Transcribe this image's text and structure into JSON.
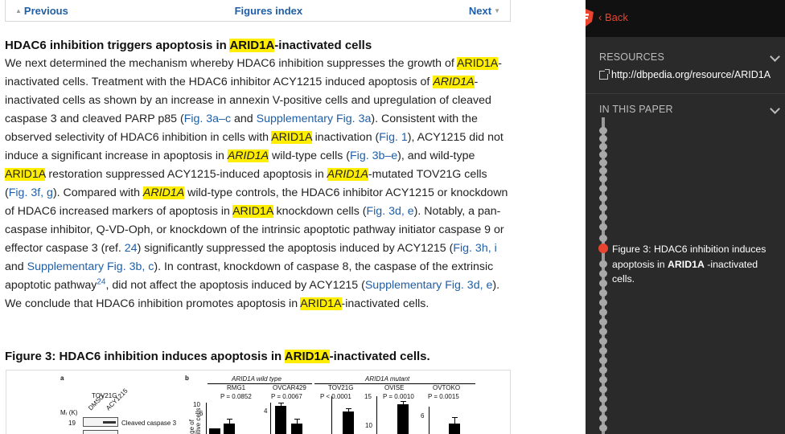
{
  "nav": {
    "previous": "Previous",
    "index": "Figures index",
    "next": "Next"
  },
  "article": {
    "section_heading_pre": "HDAC6 inhibition triggers apoptosis in ",
    "section_heading_gene": "ARID1A",
    "section_heading_post": "-inactivated cells",
    "figure_heading_pre": "Figure 3: HDAC6 inhibition induces apoptosis in ",
    "figure_heading_gene": "ARID1A",
    "figure_heading_post": "-inactivated cells."
  },
  "paragraph": {
    "s01": "We next determined the mechanism whereby HDAC6 inhibition suppresses the growth of ",
    "g01": "ARID1A",
    "s02": "-inactivated cells. Treatment with the HDAC6 inhibitor ACY1215 induced apoptosis of ",
    "g02": "ARID1A",
    "s03": "-inactivated cells as shown by an increase in annexin V-positive cells and upregulation of cleaved caspase 3 and cleaved PARP p85 (",
    "l01": "Fig. 3a–c",
    "s04": " and ",
    "l02": "Supplementary Fig. 3a",
    "s05": "). Consistent with the observed selectivity of HDAC6 inhibition in cells with ",
    "g03": "ARID1A",
    "s06": " inactivation (",
    "l03": "Fig. 1",
    "s07": "), ACY1215 did not induce a significant increase in apoptosis in ",
    "g04": "ARID1A",
    "s08": " wild-type cells (",
    "l04": "Fig. 3b–e",
    "s09": "), and wild-type ",
    "g05": "ARID1A",
    "s10": " restoration suppressed ACY1215-induced apoptosis in ",
    "g06": "ARID1A",
    "s11": "-mutated TOV21G cells (",
    "l05": "Fig. 3f, g",
    "s12": "). Compared with ",
    "g07": "ARID1A",
    "s13": " wild-type controls, the HDAC6 inhibitor ACY1215 or knockdown of HDAC6 increased markers of apoptosis in ",
    "g08": "ARID1A",
    "s14": " knockdown cells (",
    "l06": "Fig. 3d, e",
    "s15": "). Notably, a pan-caspase inhibitor, Q-VD-Oph, or knockdown of the intrinsic apoptotic pathway initiator caspase 9 or effector caspase 3 (ref. ",
    "l07": "24",
    "s16": ") significantly suppressed the apoptosis induced by ACY1215 (",
    "l08": "Fig. 3h, i",
    "s17": " and ",
    "l09": "Supplementary Fig. 3b, c",
    "s18": "). In contrast, knockdown of caspase 8, the caspase of the extrinsic apoptotic pathway",
    "l10": "24",
    "s19": ", did not affect the apoptosis induced by ACY1215 (",
    "l11": "Supplementary Fig. 3d, e",
    "s20": "). We conclude that HDAC6 inhibition promotes apoptosis in ",
    "g09": "ARID1A",
    "s21": "-inactivated cells."
  },
  "figure": {
    "panel_a": "a",
    "panel_b": "b",
    "cell_line": "TOV21G",
    "lane_1": "DMSO",
    "lane_2": "ACY1215",
    "mw_label": "Mᵣ (K)",
    "mw_value": "19",
    "blot_label": "Cleaved caspase 3",
    "group_wt": "ARID1A wild type",
    "group_mut": "ARID1A mutant",
    "ylabel_1": "ntage of",
    "ylabel_2": "positive cells",
    "lines": [
      {
        "name": "RMG1",
        "p": "P = 0.0852"
      },
      {
        "name": "OVCAR429",
        "p": "P = 0.0067"
      },
      {
        "name": "TOV21G",
        "p": "P < 0.0001"
      },
      {
        "name": "OVISE",
        "p": "P = 0.0010"
      },
      {
        "name": "OVTOKO",
        "p": "P = 0.0015"
      }
    ],
    "ticks": {
      "t6a": "6",
      "t4": "4",
      "t10a": "10",
      "t15": "15",
      "t10b": "10",
      "t6b": "6"
    }
  },
  "sidebar": {
    "back": "Back",
    "resources_title": "RESOURCES",
    "resource_link": "http://dbpedia.org/resource/ARID1A",
    "in_this_paper_title": "IN THIS PAPER",
    "caption_pre": "Figure 3: HDAC6 inhibition induces apoptosis in ",
    "caption_gene": "ARID1A",
    "caption_post": " -inactivated cells."
  },
  "colors": {
    "highlight": "#ffee00",
    "link": "#1f5fa8",
    "accent": "#e8442f",
    "sidebar_bg": "#2a2a2a"
  }
}
